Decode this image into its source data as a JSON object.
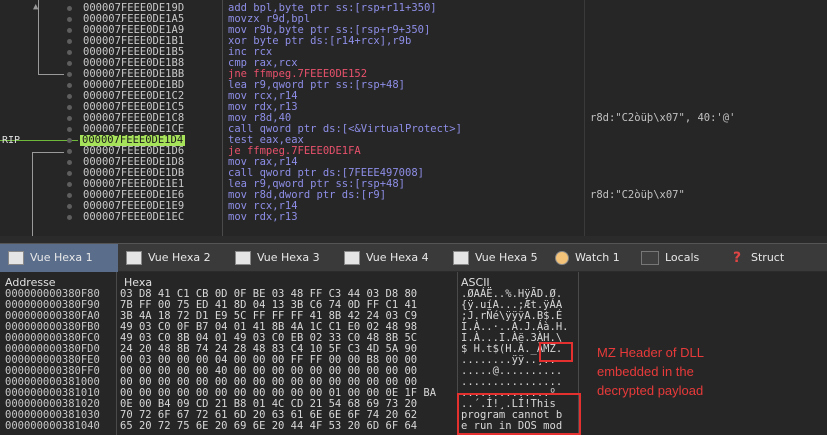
{
  "disasm": {
    "rip_label": "RIP",
    "rows": [
      {
        "addr": "000007FEEE0DE19D",
        "instr": "add bpl,byte ptr ss:[rsp+r11+350]",
        "comment": "",
        "red": false,
        "hl": false
      },
      {
        "addr": "000007FEEE0DE1A5",
        "instr": "movzx r9d,bpl",
        "comment": "",
        "red": false,
        "hl": false
      },
      {
        "addr": "000007FEEE0DE1A9",
        "instr": "mov r9b,byte ptr ss:[rsp+r9+350]",
        "comment": "",
        "red": false,
        "hl": false
      },
      {
        "addr": "000007FEEE0DE1B1",
        "instr": "xor byte ptr ds:[r14+rcx],r9b",
        "comment": "",
        "red": false,
        "hl": false
      },
      {
        "addr": "000007FEEE0DE1B5",
        "instr": "inc rcx",
        "comment": "",
        "red": false,
        "hl": false
      },
      {
        "addr": "000007FEEE0DE1B8",
        "instr": "cmp rax,rcx",
        "comment": "",
        "red": false,
        "hl": false
      },
      {
        "addr": "000007FEEE0DE1BB",
        "instr": "jne ffmpeg.7FEEE0DE152",
        "comment": "",
        "red": true,
        "hl": false
      },
      {
        "addr": "000007FEEE0DE1BD",
        "instr": "lea r9,qword ptr ss:[rsp+48]",
        "comment": "",
        "red": false,
        "hl": false
      },
      {
        "addr": "000007FEEE0DE1C2",
        "instr": "mov rcx,r14",
        "comment": "",
        "red": false,
        "hl": false
      },
      {
        "addr": "000007FEEE0DE1C5",
        "instr": "mov rdx,r13",
        "comment": "",
        "red": false,
        "hl": false
      },
      {
        "addr": "000007FEEE0DE1C8",
        "instr": "mov r8d,40",
        "comment": "r8d:\"C2òüþ\\x07\", 40:'@'",
        "red": false,
        "hl": false
      },
      {
        "addr": "000007FEEE0DE1CE",
        "instr": "call qword ptr ds:[<&VirtualProtect>]",
        "comment": "",
        "red": false,
        "hl": false
      },
      {
        "addr": "000007FEEE0DE1D4",
        "instr": "test eax,eax",
        "comment": "",
        "red": false,
        "hl": true
      },
      {
        "addr": "000007FEEE0DE1D6",
        "instr": "je ffmpeg.7FEEE0DE1FA",
        "comment": "",
        "red": true,
        "hl": false
      },
      {
        "addr": "000007FEEE0DE1D8",
        "instr": "mov rax,r14",
        "comment": "",
        "red": false,
        "hl": false
      },
      {
        "addr": "000007FEEE0DE1DB",
        "instr": "call qword ptr ds:[7FEEE497008]",
        "comment": "",
        "red": false,
        "hl": false
      },
      {
        "addr": "000007FEEE0DE1E1",
        "instr": "lea r9,qword ptr ss:[rsp+48]",
        "comment": "",
        "red": false,
        "hl": false
      },
      {
        "addr": "000007FEEE0DE1E6",
        "instr": "mov r8d,dword ptr ds:[r9]",
        "comment": "r8d:\"C2òüþ\\x07\"",
        "red": false,
        "hl": false
      },
      {
        "addr": "000007FEEE0DE1E9",
        "instr": "mov rcx,r14",
        "comment": "",
        "red": false,
        "hl": false
      },
      {
        "addr": "000007FEEE0DE1EC",
        "instr": "mov rdx,r13",
        "comment": "",
        "red": false,
        "hl": false
      }
    ]
  },
  "tabs": [
    {
      "label": "Vue Hexa 1",
      "icon": "hex-dump-icon",
      "active": true
    },
    {
      "label": "Vue Hexa 2",
      "icon": "hex-dump-icon",
      "active": false
    },
    {
      "label": "Vue Hexa 3",
      "icon": "hex-dump-icon",
      "active": false
    },
    {
      "label": "Vue Hexa 4",
      "icon": "hex-dump-icon",
      "active": false
    },
    {
      "label": "Vue Hexa 5",
      "icon": "hex-dump-icon",
      "active": false
    },
    {
      "label": "Watch 1",
      "icon": "cat-icon",
      "active": false
    },
    {
      "label": "Locals",
      "icon": "locals-icon",
      "active": false
    },
    {
      "label": "Struct",
      "icon": "struct-icon",
      "active": false
    }
  ],
  "hex": {
    "headers": {
      "address": "Addresse",
      "hex": "Hexa",
      "ascii": "ASCII"
    },
    "rows": [
      {
        "addr": "000000000380F80",
        "bytes": "03 D8 41 C1 CB 0D 0F BE 03 48 FF C3 44 03 D8 80",
        "ascii": ".ØAÁË..%.HÿÃD.Ø."
      },
      {
        "addr": "000000000380F90",
        "bytes": "7B FF 00 75 ED 41 8D 04 13 3B C6 74 0D FF C1 41",
        "ascii": "{ÿ.uíA...;Æt.ÿÁA"
      },
      {
        "addr": "000000000380FA0",
        "bytes": "3B 4A 18 72 D1 E9 5C FF FF FF 41 8B 42 24 03 C9",
        "ascii": ";J.rÑé\\ÿÿÿA.B$.É"
      },
      {
        "addr": "000000000380FB0",
        "bytes": "49 03 C0 0F B7 04 01 41 8B 4A 1C C1 E0 02 48 98",
        "ascii": "I.À..·..A.J.Áà.H."
      },
      {
        "addr": "000000000380FC0",
        "bytes": "49 03 C0 8B 04 01 49 03 C0 EB 02 33 C0 48 8B 5C",
        "ascii": "I.À...I.Àë.3ÀH.\\"
      },
      {
        "addr": "000000000380FD0",
        "bytes": "24 20 48 8B 74 24 28 48 83 C4 10 5F C3 4D 5A 90",
        "ascii": "$ H.t$(H.Ä._ÃMZ."
      },
      {
        "addr": "000000000380FE0",
        "bytes": "00 03 00 00 00 04 00 00 00 FF FF 00 00 B8 00 00",
        "ascii": "........ÿÿ..¸.."
      },
      {
        "addr": "000000000380FF0",
        "bytes": "00 00 00 00 00 40 00 00 00 00 00 00 00 00 00 00",
        "ascii": ".....@.........."
      },
      {
        "addr": "000000000381000",
        "bytes": "00 00 00 00 00 00 00 00 00 00 00 00 00 00 00 00",
        "ascii": "................"
      },
      {
        "addr": "000000000381010",
        "bytes": "00 00 00 00 00 00 00 00 00 00 00 01 00 00 0E 1F BA",
        "ascii": "..............º"
      },
      {
        "addr": "000000000381020",
        "bytes": "0E 00 B4 09 CD 21 B8 01 4C CD 21 54 68 69 73 20",
        "ascii": "..´.Í!¸.LÍ!This "
      },
      {
        "addr": "000000000381030",
        "bytes": "70 72 6F 67 72 61 6D 20 63 61 6E 6E 6F 74 20 62",
        "ascii": "program cannot b"
      },
      {
        "addr": "000000000381040",
        "bytes": "65 20 72 75 6E 20 69 6E 20 44 4F 53 20 6D 6F 64",
        "ascii": "e run in DOS mod"
      }
    ]
  },
  "annotation": "MZ Header of DLL embedded in the decrypted payload",
  "colors": {
    "highlight": "#a7e35a",
    "annotation": "#e83a3a",
    "jump": "#e8516c",
    "instr": "#8e8ee8"
  }
}
